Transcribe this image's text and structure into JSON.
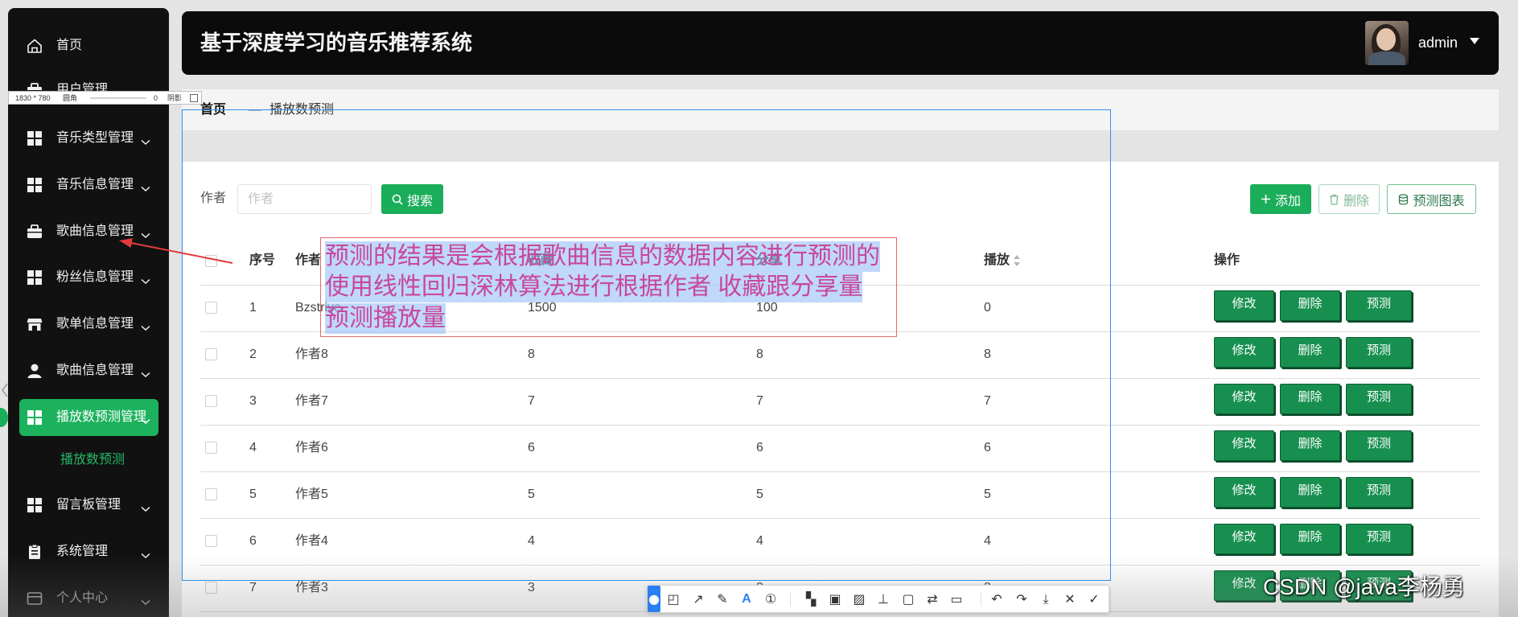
{
  "header": {
    "title": "基于深度学习的音乐推荐系统",
    "username": "admin",
    "avatar_icon": "avatar-icon",
    "caret_icon": "caret-down-icon"
  },
  "sidebar": {
    "items": [
      {
        "label": "首页",
        "icon": "home-icon",
        "expandable": false
      },
      {
        "label": "用户管理",
        "icon": "briefcase-icon",
        "expandable": true
      },
      {
        "label": "音乐类型管理",
        "icon": "grid-icon",
        "expandable": true
      },
      {
        "label": "音乐信息管理",
        "icon": "grid-icon",
        "expandable": true
      },
      {
        "label": "歌曲信息管理",
        "icon": "briefcase-icon",
        "expandable": true
      },
      {
        "label": "粉丝信息管理",
        "icon": "grid-icon",
        "expandable": true
      },
      {
        "label": "歌单信息管理",
        "icon": "shop-icon",
        "expandable": true
      },
      {
        "label": "歌曲信息管理",
        "icon": "user-icon",
        "expandable": true
      },
      {
        "label": "播放数预测管理",
        "icon": "grid-icon",
        "expandable": true,
        "active": true
      },
      {
        "label": "留言板管理",
        "icon": "grid-icon",
        "expandable": true
      },
      {
        "label": "系统管理",
        "icon": "clipboard-icon",
        "expandable": true
      },
      {
        "label": "个人中心",
        "icon": "wallet-icon",
        "expandable": true
      }
    ],
    "submenu_label": "播放数预测"
  },
  "breadcrumb": {
    "home": "首页",
    "separator": "—",
    "current": "播放数预测"
  },
  "search": {
    "label": "作者",
    "placeholder": "作者",
    "button": "搜索",
    "icon": "search-icon"
  },
  "toolbar": {
    "add": "添加",
    "delete": "删除",
    "chart": "预测图表"
  },
  "table": {
    "headers": {
      "index": "序号",
      "author": "作者",
      "favorites": "收藏",
      "shares": "分享",
      "plays": "播放",
      "actions": "操作"
    },
    "rows": [
      {
        "index": "1",
        "author": "Bzstrive",
        "favorites": "1500",
        "shares": "100",
        "plays": "0"
      },
      {
        "index": "2",
        "author": "作者8",
        "favorites": "8",
        "shares": "8",
        "plays": "8"
      },
      {
        "index": "3",
        "author": "作者7",
        "favorites": "7",
        "shares": "7",
        "plays": "7"
      },
      {
        "index": "4",
        "author": "作者6",
        "favorites": "6",
        "shares": "6",
        "plays": "6"
      },
      {
        "index": "5",
        "author": "作者5",
        "favorites": "5",
        "shares": "5",
        "plays": "5"
      },
      {
        "index": "6",
        "author": "作者4",
        "favorites": "4",
        "shares": "4",
        "plays": "4"
      },
      {
        "index": "7",
        "author": "作者3",
        "favorites": "3",
        "shares": "3",
        "plays": "3"
      }
    ],
    "row_actions": {
      "edit": "修改",
      "delete": "删除",
      "predict": "预测"
    }
  },
  "annotation": {
    "lines": [
      "预测的结果是会根据歌曲信息的数据内容进行预测的",
      "使用线性回归深林算法进行根据作者 收藏跟分享量",
      "预测播放量"
    ]
  },
  "capture_tool": {
    "size": "1830 * 780",
    "radius_label": "圆角",
    "radius_value": "0",
    "shadow_label": "阴影",
    "tools": [
      "pin-icon",
      "shape-icon",
      "arrow-icon",
      "pen-icon",
      "text-icon",
      "number-icon",
      "mosaic-icon",
      "fill-icon",
      "hatch-icon",
      "pin-top-icon",
      "screen-icon",
      "translate-icon",
      "ocr-icon",
      "undo-icon",
      "redo-icon",
      "download-icon",
      "close-icon",
      "confirm-icon"
    ]
  },
  "watermark": "CSDN @java李杨勇",
  "colors": {
    "primary_green": "#1aad5a",
    "sidebar_bg": "#111111",
    "header_bg": "#0b0b0b",
    "action_button": "#17904f",
    "annotation_text": "#c8489c",
    "annotation_border": "#e36a6a",
    "selection_border": "#2e8ff0",
    "arrow": "#e03c3c"
  }
}
